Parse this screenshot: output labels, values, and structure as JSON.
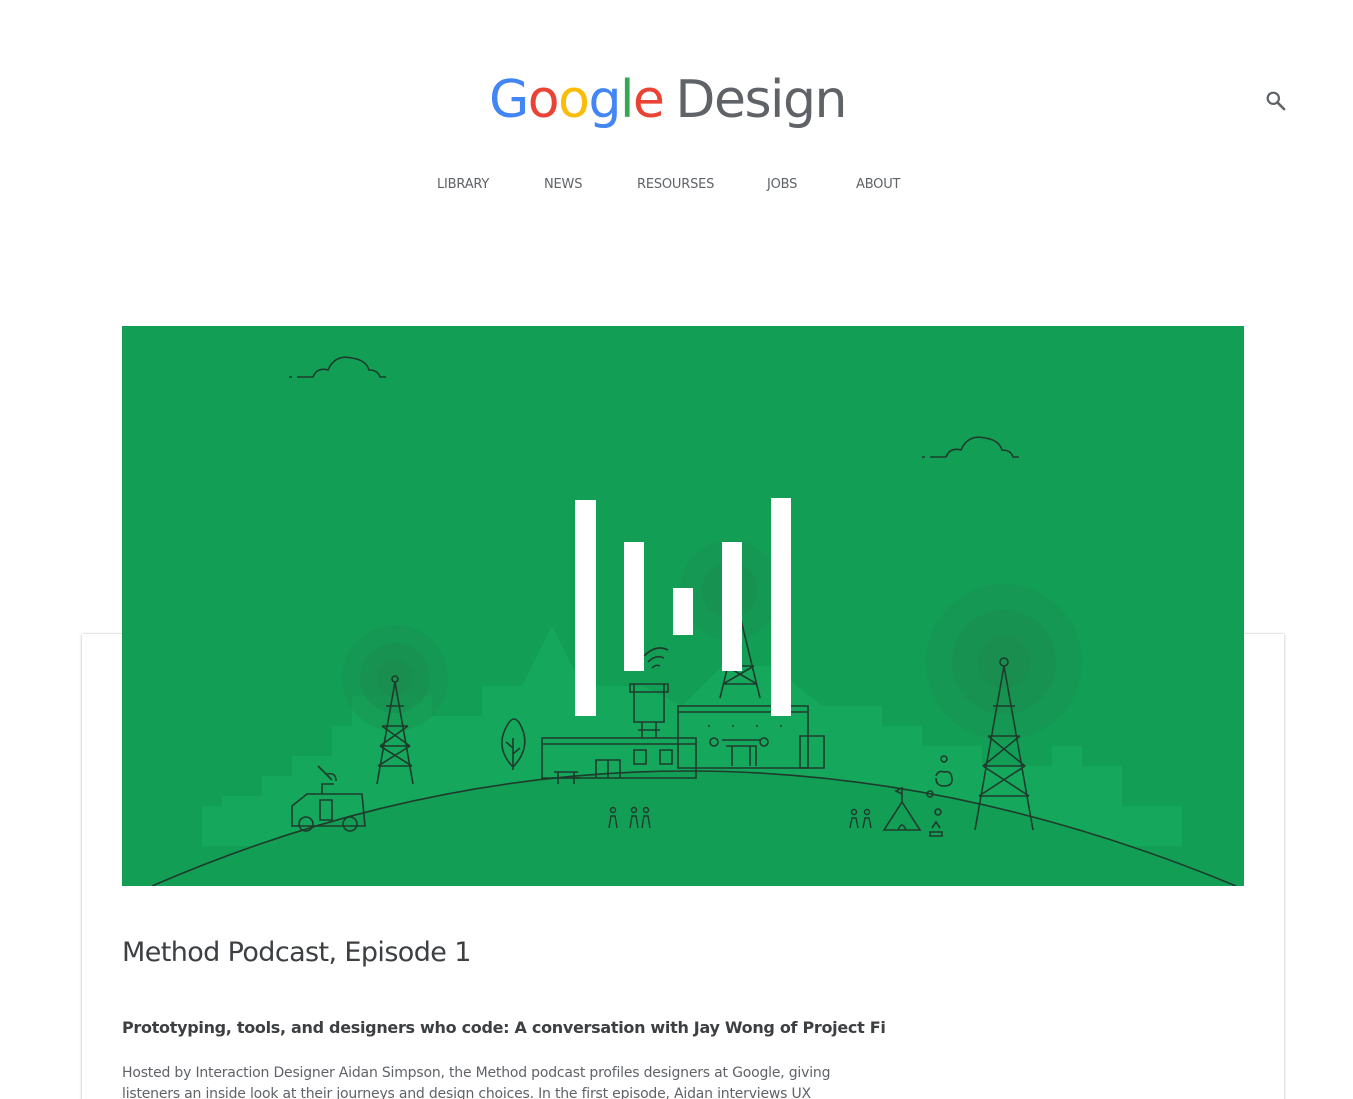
{
  "header": {
    "logo": {
      "google_letters": [
        {
          "char": "G",
          "color": "#4285f4"
        },
        {
          "char": "o",
          "color": "#ea4335"
        },
        {
          "char": "o",
          "color": "#fbbc05"
        },
        {
          "char": "g",
          "color": "#4285f4"
        },
        {
          "char": "l",
          "color": "#34a853"
        },
        {
          "char": "e",
          "color": "#ea4335"
        }
      ],
      "design_word": "Design"
    },
    "search_icon": "search-icon"
  },
  "nav": {
    "items": [
      {
        "label": "LIBRARY"
      },
      {
        "label": "NEWS"
      },
      {
        "label": "RESOURSES"
      },
      {
        "label": "JOBS"
      },
      {
        "label": "ABOUT"
      }
    ]
  },
  "article": {
    "hero": {
      "background_color": "#139e56",
      "illustration": "method-podcast-illustration"
    },
    "title": "Method Podcast, Episode 1",
    "subtitle": "Prototyping, tools, and designers who code: A conversation with Jay Wong of Project Fi",
    "body": "Hosted by Interaction Designer Aidan Simpson, the Method podcast profiles designers at Google, giving listeners an inside look at their journeys and design choices. In the first episode, Aidan interviews UX"
  }
}
